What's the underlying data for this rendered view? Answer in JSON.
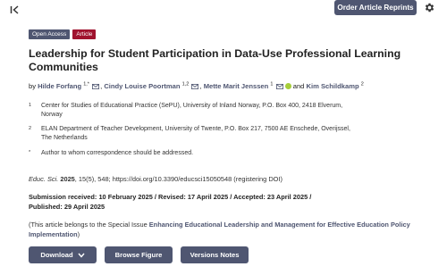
{
  "toolbar": {
    "collapse_icon": "collapse-left-icon",
    "reprints_label": "Order Article Reprints",
    "settings_icon": "gear-icon"
  },
  "badges": {
    "open_access": "Open Access",
    "type": "Article"
  },
  "article": {
    "title": "Leadership for Student Participation in Data-Use Professional Learning Communities"
  },
  "authors": {
    "prefix": "by",
    "list": [
      {
        "name": "Hilde Forfang",
        "sup": "1,*"
      },
      {
        "name": "Cindy Louise Poortman",
        "sup": "1,2"
      },
      {
        "name": "Mette Marit Jenssen",
        "sup": "1"
      },
      {
        "name": "Kim Schildkamp",
        "sup": "2"
      }
    ],
    "and": "and"
  },
  "affiliations": [
    {
      "num": "1",
      "line1": "Center for Studies of Educational Practice (SePU), University of Inland Norway, P.O. Box 400, 2418 Elverum,",
      "line2": "Norway"
    },
    {
      "num": "2",
      "line1": "ELAN Department of Teacher Development, University of Twente, P.O. Box 217, 7500 AE Enschede, Overijssel,",
      "line2": "The Netherlands"
    },
    {
      "num": "*",
      "line1": "Author to whom correspondence should be addressed.",
      "line2": ""
    }
  ],
  "citation": {
    "journal": "Educ. Sci.",
    "year": "2025",
    "volume_issue": ", 15(5), 548; ",
    "doi": "https://doi.org/10.3390/educsci15050548 (registering DOI)"
  },
  "dates": {
    "line1": "Submission received: 10 February 2025 / Revised: 17 April 2025 / Accepted: 23 April 2025 /",
    "line2": "Published: 29 April 2025"
  },
  "special_issue": {
    "prefix": "(This article belongs to the Special Issue ",
    "link": "Enhancing Educational Leadership and Management for Effective Education Policy Implementation",
    "suffix": ")"
  },
  "actions": {
    "download": "Download",
    "browse": "Browse Figure",
    "versions": "Versions Notes"
  },
  "colors": {
    "primary": "#4f5671",
    "article_badge": "#a0132e",
    "orcid": "#a6ce39"
  }
}
